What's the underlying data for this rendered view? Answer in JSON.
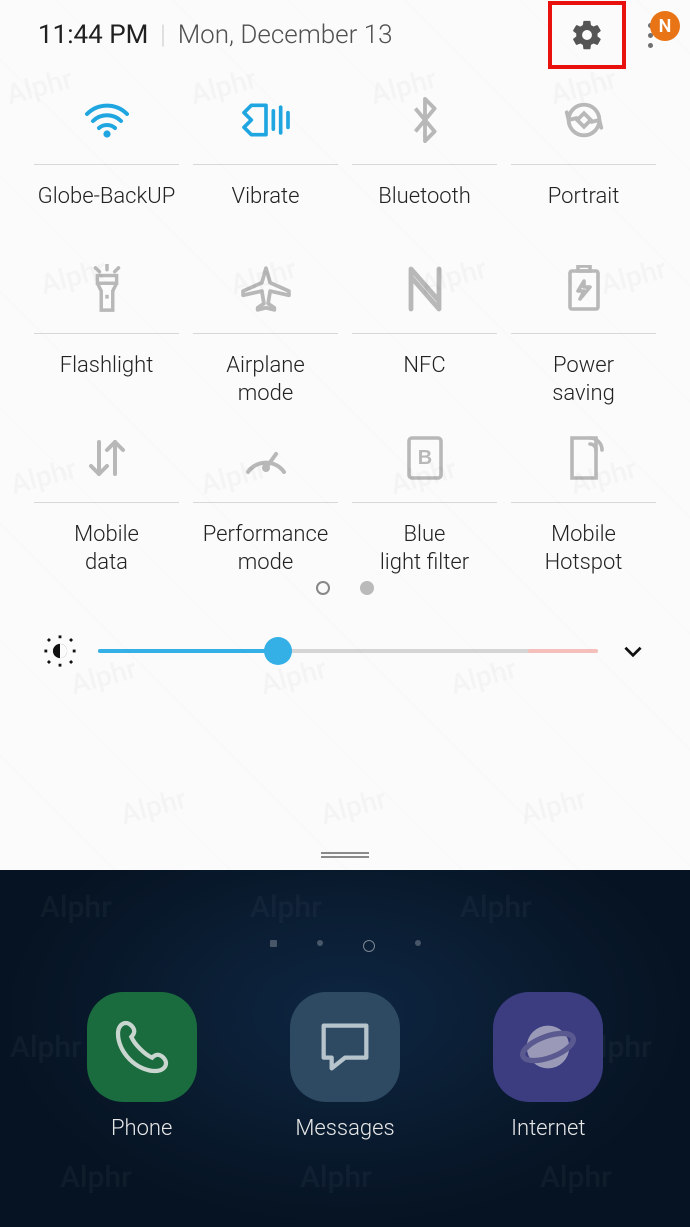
{
  "header": {
    "time": "11:44 PM",
    "date": "Mon, December 13",
    "badge_letter": "N"
  },
  "colors": {
    "active": "#1fa6e0",
    "inactive": "#b8b8b8",
    "highlight_box": "#e8110d",
    "badge": "#e87416"
  },
  "tiles": [
    {
      "icon": "wifi-icon",
      "label": "Globe-BackUP",
      "active": true
    },
    {
      "icon": "vibrate-icon",
      "label": "Vibrate",
      "active": true
    },
    {
      "icon": "bluetooth-icon",
      "label": "Bluetooth",
      "active": false
    },
    {
      "icon": "rotation-lock-icon",
      "label": "Portrait",
      "active": false
    },
    {
      "icon": "flashlight-icon",
      "label": "Flashlight",
      "active": false
    },
    {
      "icon": "airplane-icon",
      "label": "Airplane mode",
      "active": false
    },
    {
      "icon": "nfc-icon",
      "label": "NFC",
      "active": false
    },
    {
      "icon": "power-saving-icon",
      "label": "Power saving",
      "active": false
    },
    {
      "icon": "mobile-data-icon",
      "label": "Mobile data",
      "active": false
    },
    {
      "icon": "performance-icon",
      "label": "Performance mode",
      "active": false
    },
    {
      "icon": "blue-light-icon",
      "label": "Blue light filter",
      "active": false
    },
    {
      "icon": "hotspot-icon",
      "label": "Mobile Hotspot",
      "active": false
    }
  ],
  "pages": {
    "count": 2,
    "current": 0
  },
  "brightness": {
    "percent": 36
  },
  "dock": [
    {
      "icon": "phone-app-icon",
      "label": "Phone",
      "bg": "#1a6b3e"
    },
    {
      "icon": "messages-app-icon",
      "label": "Messages",
      "bg": "#2d4a62"
    },
    {
      "icon": "internet-app-icon",
      "label": "Internet",
      "bg": "#3b3d80"
    }
  ],
  "watermark_text": "Alphr"
}
